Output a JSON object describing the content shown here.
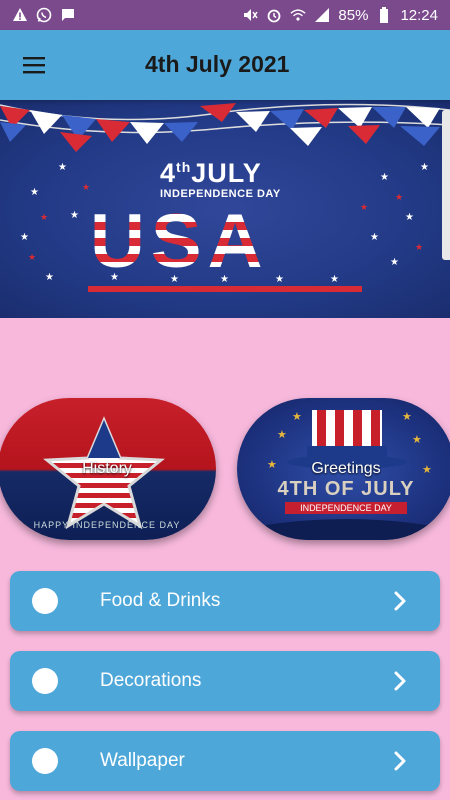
{
  "status_bar": {
    "battery": "85%",
    "time": "12:24",
    "left_icons": [
      "warning-icon",
      "whatsapp-icon",
      "message-icon"
    ],
    "right_icons": [
      "mute-icon",
      "alarm-icon",
      "wifi-icon",
      "signal-icon",
      "battery-icon"
    ]
  },
  "app_bar": {
    "title": "4th July 2021",
    "menu_icon": "menu-icon"
  },
  "banner": {
    "headline": "4",
    "headline_sup": "th",
    "headline_rest": "JULY",
    "subheading": "INDEPENDENCE DAY",
    "big_text": "USA"
  },
  "categories": [
    {
      "label": "History",
      "caption": "HAPPY INDEPENDENCE DAY"
    },
    {
      "label": "Greetings",
      "image_text": "4TH OF JULY",
      "image_subtext": "INDEPENDENCE DAY"
    }
  ],
  "menu_items": [
    {
      "label": "Food & Drinks"
    },
    {
      "label": "Decorations"
    },
    {
      "label": "Wallpaper"
    }
  ],
  "colors": {
    "status_bar": "#7b4a8d",
    "app_bar": "#4ea7d9",
    "background": "#f7b8dc",
    "list_item": "#4ea7d9",
    "usa_red": "#d82b35",
    "usa_blue": "#223a86"
  }
}
